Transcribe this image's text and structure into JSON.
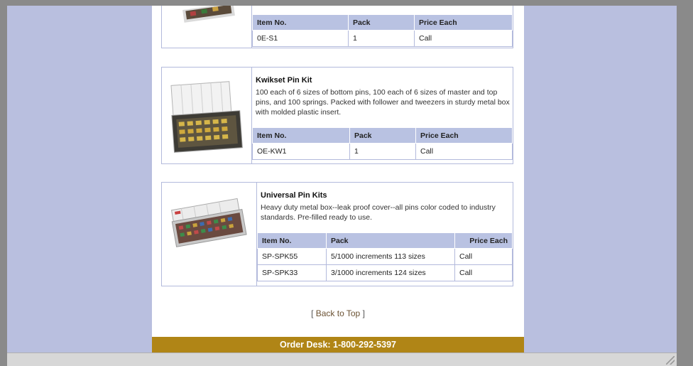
{
  "products": [
    {
      "name": "",
      "headers": [
        "Item No.",
        "Pack",
        "Price Each"
      ],
      "rows": [
        [
          "0E-S1",
          "1",
          "Call"
        ]
      ]
    },
    {
      "name": "Kwikset Pin Kit",
      "description": "100 each of 6 sizes of bottom pins, 100 each of 6 sizes of master and top pins, and 100 springs. Packed with follower and tweezers in sturdy metal box with molded plastic insert.",
      "headers": [
        "Item No.",
        "Pack",
        "Price Each"
      ],
      "rows": [
        [
          "OE-KW1",
          "1",
          "Call"
        ]
      ]
    },
    {
      "name": "Universal Pin Kits",
      "description": "Heavy duty metal box--leak proof cover--all pins color coded to industry standards. Pre-filled ready to use.",
      "headers": [
        "Item No.",
        "Pack",
        "Price Each"
      ],
      "rows": [
        [
          "SP-SPK55",
          "5/1000 increments 113 sizes",
          "Call"
        ],
        [
          "SP-SPK33",
          "3/1000 increments 124 sizes",
          "Call"
        ]
      ]
    }
  ],
  "back_to_top": {
    "open": "[ ",
    "label": "Back to Top",
    "close": " ]"
  },
  "order_desk": "Order Desk: 1-800-292-5397",
  "colors": {
    "page_bg": "#b9bfdf",
    "header_cell": "#b9c2e2",
    "order_bar": "#b08516",
    "border": "#b3badc"
  }
}
